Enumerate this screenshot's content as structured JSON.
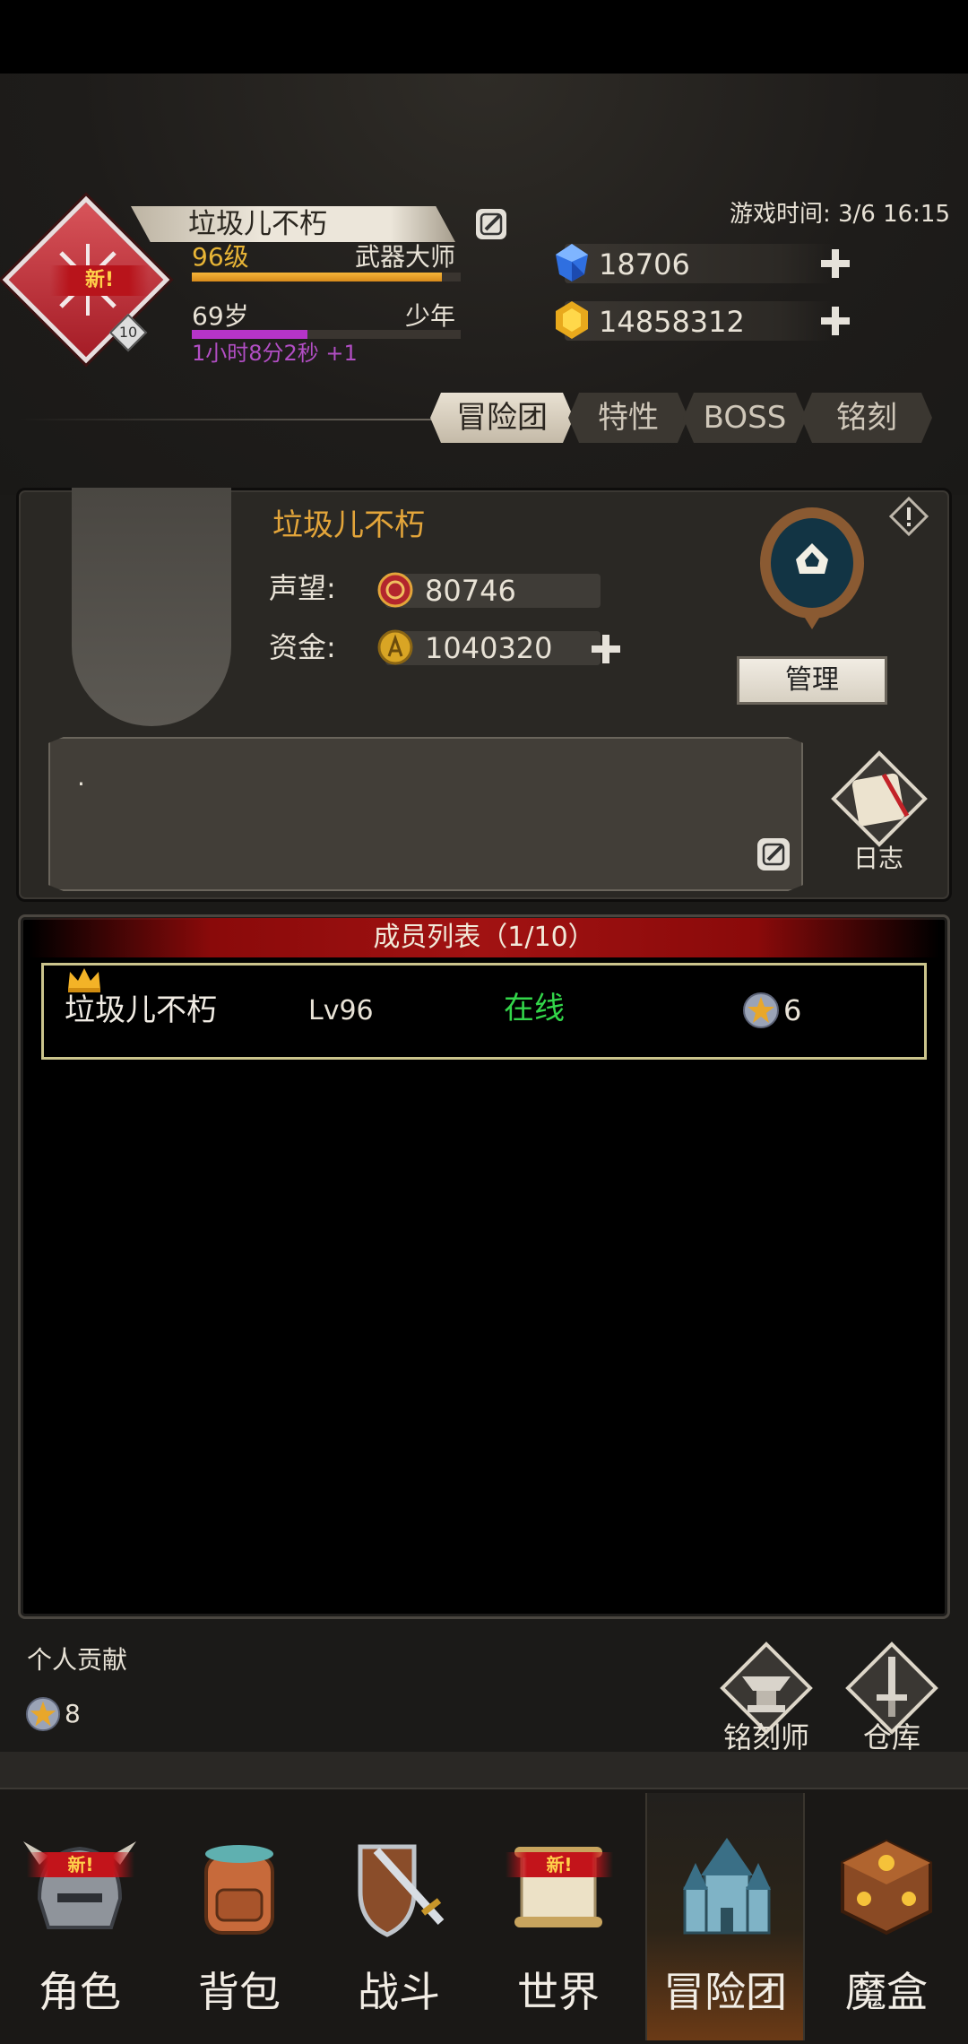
{
  "profile": {
    "avatar_badge": "新!",
    "avatar_rank": "10",
    "name": "垃圾儿不朽",
    "level": "96级",
    "class": "武器大师",
    "level_progress": 0.93,
    "age": "69岁",
    "age_stage": "少年",
    "age_progress": 0.43,
    "age_timer": "1小时8分2秒 +1"
  },
  "game_time": "游戏时间: 3/6 16:15",
  "currency": {
    "gems": "18706",
    "gold": "14858312"
  },
  "tabs": [
    "冒险团",
    "特性",
    "BOSS",
    "铭刻"
  ],
  "guild": {
    "name": "垃圾儿不朽",
    "reputation_label": "声望:",
    "reputation": "80746",
    "funds_label": "资金:",
    "funds": "1040320",
    "manage_label": "管理",
    "notice": ".",
    "log_label": "日志"
  },
  "members": {
    "header": "成员列表（1/10）",
    "rows": [
      {
        "name": "垃圾儿不朽",
        "level": "Lv96",
        "status": "在线",
        "contribution": "6"
      }
    ]
  },
  "footer": {
    "contribution_label": "个人贡献",
    "contribution_value": "8",
    "engraver_label": "铭刻师",
    "warehouse_label": "仓库"
  },
  "nav": {
    "new_badge": "新!",
    "items": [
      "角色",
      "背包",
      "战斗",
      "世界",
      "冒险团",
      "魔盒"
    ]
  },
  "colors": {
    "accent_gold": "#e3a53a",
    "online_green": "#33d64a",
    "age_purple": "#b24ec4",
    "members_header_red": "#a11212"
  }
}
